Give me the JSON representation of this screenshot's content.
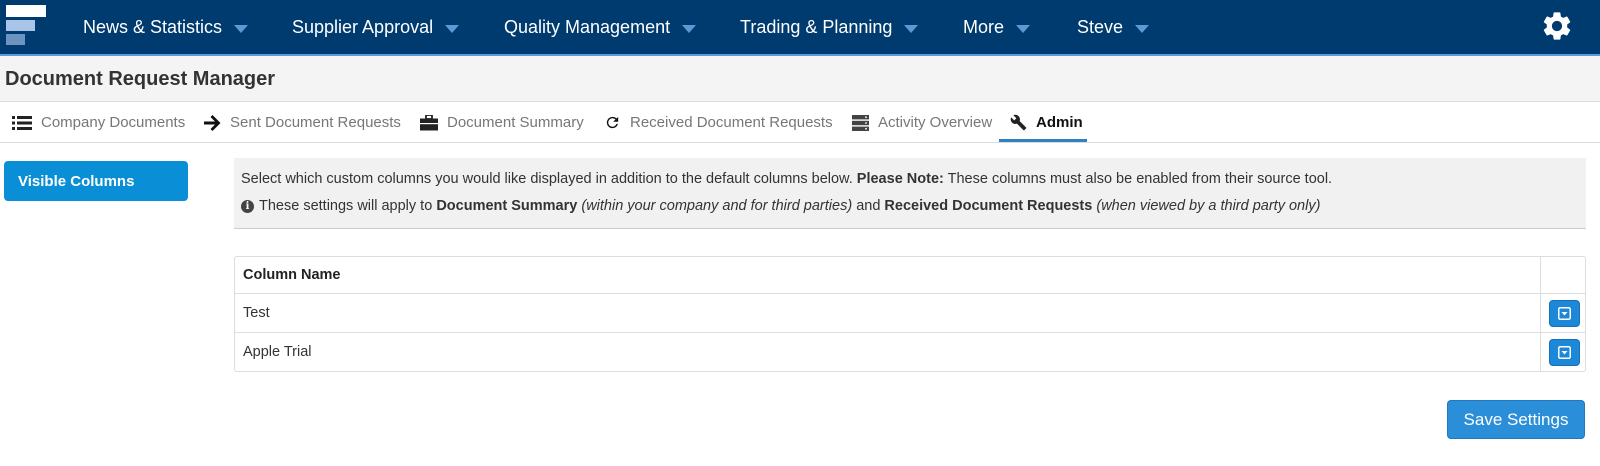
{
  "nav": {
    "items": [
      {
        "label": "News & Statistics"
      },
      {
        "label": "Supplier Approval"
      },
      {
        "label": "Quality Management"
      },
      {
        "label": "Trading & Planning"
      },
      {
        "label": "More"
      },
      {
        "label": "Steve"
      }
    ],
    "settings_icon": "gear-icon"
  },
  "header": {
    "title": "Document Request Manager"
  },
  "tabs": [
    {
      "label": "Company Documents",
      "icon": "list-icon"
    },
    {
      "label": "Sent Document Requests",
      "icon": "arrow-right-icon"
    },
    {
      "label": "Document Summary",
      "icon": "briefcase-icon"
    },
    {
      "label": "Received Document Requests",
      "icon": "refresh-icon"
    },
    {
      "label": "Activity Overview",
      "icon": "server-icon"
    },
    {
      "label": "Admin",
      "icon": "wrench-icon",
      "active": true
    }
  ],
  "sidebar": {
    "active_item": "Visible Columns"
  },
  "info": {
    "line1_text": "Select which custom columns you would like displayed in addition to the default columns below.",
    "line1_bold": "Please Note:",
    "line1_tail": "These columns must also be enabled from their source tool.",
    "line2_a": "These settings will apply to",
    "line2_b": "Document Summary",
    "line2_c": "(within your company and for third parties)",
    "line2_d": "and",
    "line2_e": "Received Document Requests",
    "line2_f": "(when viewed by a third party only)"
  },
  "table": {
    "header": "Column Name",
    "rows": [
      {
        "name": "Test"
      },
      {
        "name": "Apple Trial"
      }
    ]
  },
  "actions": {
    "save_label": "Save Settings"
  },
  "colors": {
    "navbar": "#003b6f",
    "accent": "#0a8fd7",
    "button": "#2b8ed9"
  }
}
